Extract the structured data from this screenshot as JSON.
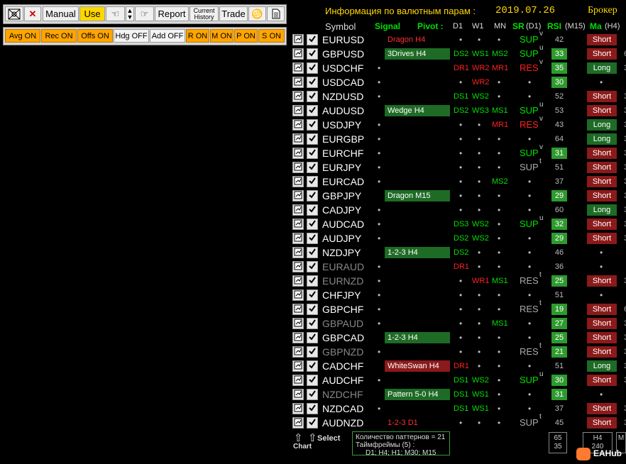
{
  "toolbar": {
    "manual_label": "Manual",
    "use_label": "Use",
    "report_label": "Report",
    "history_line1": "Current",
    "history_line2": "History",
    "trade_label": "Trade"
  },
  "options": [
    "Avg ON",
    "Rec ON",
    "Offs ON",
    "Hdg OFF",
    "Add OFF",
    "R ON",
    "M ON",
    "P ON",
    "S ON"
  ],
  "header": {
    "title": "Информация по валютным парам :",
    "date": "2019.07.26",
    "broker": "Брокер"
  },
  "columns": {
    "symbol": "Symbol",
    "signal": "Signal",
    "pivot": "Pivot :",
    "d1": "D1",
    "w1": "W1",
    "mn": "MN",
    "sr": "SR",
    "sr_tf": "(D1)",
    "rsi": "RSI",
    "rsi_tf": "(M15)",
    "ma": "Ma",
    "ma_tf": "(H4)"
  },
  "rows": [
    {
      "symbol": "EURUSD",
      "dim": false,
      "signal": "Dragon H4",
      "sigstyle": "t",
      "d1": "",
      "w1": "",
      "mn": "",
      "sr": "SUP",
      "srsup": "v",
      "rsi": "42",
      "rsi_hi": false,
      "ma": "Short",
      "extra": ""
    },
    {
      "symbol": "GBPUSD",
      "dim": false,
      "signal": "3Drives H4",
      "sigstyle": "g",
      "d1": "DS2",
      "w1": "WS1",
      "mn": "MS2",
      "sr": "SUP",
      "srsup": "u",
      "rsi": "33",
      "rsi_hi": true,
      "ma": "Short",
      "extra": "6"
    },
    {
      "symbol": "USDCHF",
      "dim": false,
      "signal": "",
      "sigstyle": "",
      "d1": "DR1",
      "w1": "WR2",
      "mn": "MR1",
      "sr": "RES",
      "srsup": "v",
      "rsi": "35",
      "rsi_hi": true,
      "ma": "Long",
      "extra": "3"
    },
    {
      "symbol": "USDCAD",
      "dim": false,
      "signal": "",
      "sigstyle": "",
      "d1": "",
      "w1": "WR2",
      "mn": "",
      "sr": "",
      "srsup": "",
      "rsi": "30",
      "rsi_hi": true,
      "ma": "",
      "extra": ""
    },
    {
      "symbol": "NZDUSD",
      "dim": false,
      "signal": "",
      "sigstyle": "",
      "d1": "DS1",
      "w1": "WS2",
      "mn": "",
      "sr": "",
      "srsup": "",
      "rsi": "52",
      "rsi_hi": false,
      "ma": "Short",
      "extra": "3"
    },
    {
      "symbol": "AUDUSD",
      "dim": false,
      "signal": "Wedge H4",
      "sigstyle": "g",
      "d1": "DS2",
      "w1": "WS3",
      "mn": "MS1",
      "sr": "SUP",
      "srsup": "u",
      "rsi": "53",
      "rsi_hi": false,
      "ma": "Short",
      "extra": "3"
    },
    {
      "symbol": "USDJPY",
      "dim": false,
      "signal": "",
      "sigstyle": "",
      "d1": "",
      "w1": "",
      "mn": "MR1",
      "sr": "RES",
      "srsup": "v",
      "rsi": "43",
      "rsi_hi": false,
      "ma": "Long",
      "extra": "3"
    },
    {
      "symbol": "EURGBP",
      "dim": false,
      "signal": "",
      "sigstyle": "",
      "d1": "",
      "w1": "",
      "mn": "",
      "sr": "",
      "srsup": "",
      "rsi": "64",
      "rsi_hi": false,
      "ma": "Long",
      "extra": "3"
    },
    {
      "symbol": "EURCHF",
      "dim": false,
      "signal": "",
      "sigstyle": "",
      "d1": "",
      "w1": "",
      "mn": "",
      "sr": "SUP",
      "srsup": "v",
      "rsi": "31",
      "rsi_hi": true,
      "ma": "Short",
      "extra": "3"
    },
    {
      "symbol": "EURJPY",
      "dim": false,
      "signal": "",
      "sigstyle": "",
      "d1": "",
      "w1": "",
      "mn": "",
      "sr": "SUP",
      "srsup": "t",
      "rsi": "51",
      "rsi_hi": false,
      "ma": "Short",
      "extra": "3"
    },
    {
      "symbol": "EURCAD",
      "dim": false,
      "signal": "",
      "sigstyle": "",
      "d1": "",
      "w1": "",
      "mn": "MS2",
      "sr": "",
      "srsup": "",
      "rsi": "37",
      "rsi_hi": false,
      "ma": "Short",
      "extra": "3"
    },
    {
      "symbol": "GBPJPY",
      "dim": false,
      "signal": "Dragon M15",
      "sigstyle": "g",
      "d1": "",
      "w1": "",
      "mn": "",
      "sr": "",
      "srsup": "",
      "rsi": "29",
      "rsi_hi": true,
      "ma": "Short",
      "extra": "3"
    },
    {
      "symbol": "CADJPY",
      "dim": false,
      "signal": "",
      "sigstyle": "",
      "d1": "",
      "w1": "",
      "mn": "",
      "sr": "",
      "srsup": "",
      "rsi": "60",
      "rsi_hi": false,
      "ma": "Long",
      "extra": "3"
    },
    {
      "symbol": "AUDCAD",
      "dim": false,
      "signal": "",
      "sigstyle": "",
      "d1": "DS3",
      "w1": "WS2",
      "mn": "",
      "sr": "SUP",
      "srsup": "u",
      "rsi": "32",
      "rsi_hi": true,
      "ma": "Short",
      "extra": "3"
    },
    {
      "symbol": "AUDJPY",
      "dim": false,
      "signal": "",
      "sigstyle": "",
      "d1": "DS2",
      "w1": "WS2",
      "mn": "",
      "sr": "",
      "srsup": "",
      "rsi": "29",
      "rsi_hi": true,
      "ma": "Short",
      "extra": "3"
    },
    {
      "symbol": "NZDJPY",
      "dim": false,
      "signal": "1-2-3 H4",
      "sigstyle": "g",
      "d1": "DS2",
      "w1": "",
      "mn": "",
      "sr": "",
      "srsup": "",
      "rsi": "46",
      "rsi_hi": false,
      "ma": "",
      "extra": ""
    },
    {
      "symbol": "EURAUD",
      "dim": true,
      "signal": "",
      "sigstyle": "",
      "d1": "DR1",
      "w1": "",
      "mn": "",
      "sr": "",
      "srsup": "",
      "rsi": "36",
      "rsi_hi": false,
      "ma": "",
      "extra": ""
    },
    {
      "symbol": "EURNZD",
      "dim": true,
      "signal": "",
      "sigstyle": "",
      "d1": "",
      "w1": "WR1",
      "mn": "MS1",
      "sr": "RES",
      "srsup": "t",
      "rsi": "25",
      "rsi_hi": true,
      "ma": "Short",
      "extra": "3"
    },
    {
      "symbol": "CHFJPY",
      "dim": false,
      "signal": "",
      "sigstyle": "",
      "d1": "",
      "w1": "",
      "mn": "",
      "sr": "",
      "srsup": "",
      "rsi": "51",
      "rsi_hi": false,
      "ma": "",
      "extra": ""
    },
    {
      "symbol": "GBPCHF",
      "dim": false,
      "signal": "",
      "sigstyle": "",
      "d1": "",
      "w1": "",
      "mn": "",
      "sr": "RES",
      "srsup": "t",
      "rsi": "19",
      "rsi_hi": true,
      "ma": "Short",
      "extra": "6"
    },
    {
      "symbol": "GBPAUD",
      "dim": true,
      "signal": "",
      "sigstyle": "",
      "d1": "",
      "w1": "",
      "mn": "MS1",
      "sr": "",
      "srsup": "",
      "rsi": "27",
      "rsi_hi": true,
      "ma": "Short",
      "extra": "3"
    },
    {
      "symbol": "GBPCAD",
      "dim": false,
      "signal": "1-2-3 H4",
      "sigstyle": "g",
      "d1": "",
      "w1": "",
      "mn": "",
      "sr": "",
      "srsup": "",
      "rsi": "25",
      "rsi_hi": true,
      "ma": "Short",
      "extra": "3"
    },
    {
      "symbol": "GBPNZD",
      "dim": true,
      "signal": "",
      "sigstyle": "",
      "d1": "",
      "w1": "",
      "mn": "",
      "sr": "RES",
      "srsup": "t",
      "rsi": "21",
      "rsi_hi": true,
      "ma": "Short",
      "extra": "3"
    },
    {
      "symbol": "CADCHF",
      "dim": false,
      "signal": "WhiteSwan H4",
      "sigstyle": "r",
      "d1": "DR1",
      "w1": "",
      "mn": "",
      "sr": "",
      "srsup": "",
      "rsi": "51",
      "rsi_hi": false,
      "ma": "Long",
      "extra": "3"
    },
    {
      "symbol": "AUDCHF",
      "dim": false,
      "signal": "",
      "sigstyle": "",
      "d1": "DS1",
      "w1": "WS2",
      "mn": "",
      "sr": "SUP",
      "srsup": "u",
      "rsi": "30",
      "rsi_hi": true,
      "ma": "Short",
      "extra": "3"
    },
    {
      "symbol": "NZDCHF",
      "dim": true,
      "signal": "Pattern 5-0 H4",
      "sigstyle": "g",
      "d1": "DS1",
      "w1": "WS1",
      "mn": "",
      "sr": "",
      "srsup": "",
      "rsi": "31",
      "rsi_hi": true,
      "ma": "",
      "extra": ""
    },
    {
      "symbol": "NZDCAD",
      "dim": false,
      "signal": "",
      "sigstyle": "",
      "d1": "DS1",
      "w1": "WS1",
      "mn": "",
      "sr": "",
      "srsup": "",
      "rsi": "37",
      "rsi_hi": false,
      "ma": "Short",
      "extra": "3"
    },
    {
      "symbol": "AUDNZD",
      "dim": false,
      "signal": "1-2-3 D1",
      "sigstyle": "t",
      "d1": "",
      "w1": "",
      "mn": "",
      "sr": "SUP",
      "srsup": "t",
      "rsi": "45",
      "rsi_hi": false,
      "ma": "Short",
      "extra": "3"
    }
  ],
  "footer": {
    "chart_label": "Chart",
    "select_label": "Select",
    "info_line1": "Количество паттернов = 21",
    "info_line2": "Таймфреймы (5) :",
    "info_line3": "D1; H4; H1; M30; M15",
    "box_rsi_top": "65",
    "box_rsi_bottom": "35",
    "box_tf_top": "H4",
    "box_tf_bottom": "240",
    "box_m": "M",
    "brand": "EAHub"
  },
  "colors": {
    "gold": "#ffd700",
    "green": "#00e000",
    "red": "#ff2020",
    "signal_green": "#1e6b25",
    "signal_red": "#8b1a1a"
  }
}
